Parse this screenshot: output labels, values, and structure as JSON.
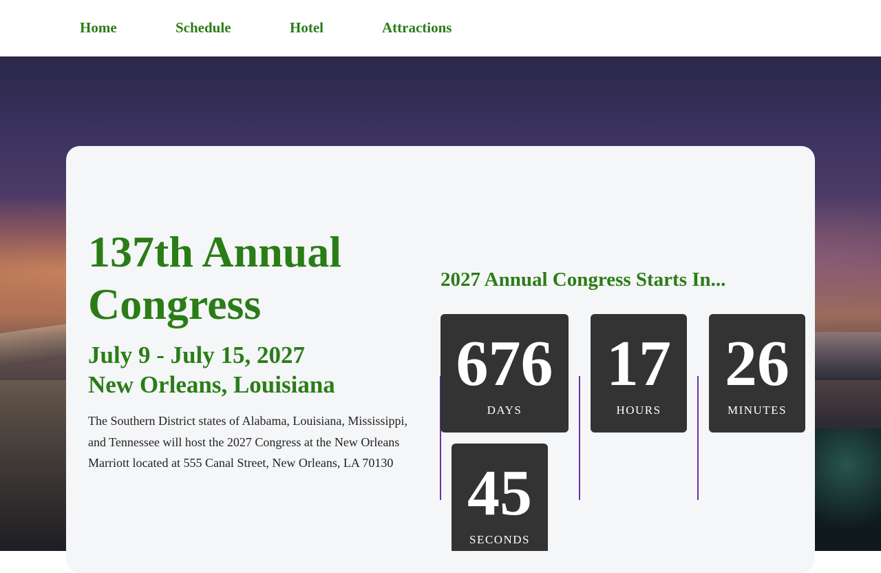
{
  "nav": {
    "items": [
      {
        "label": "Home"
      },
      {
        "label": "Schedule"
      },
      {
        "label": "Hotel"
      },
      {
        "label": "Attractions"
      }
    ]
  },
  "event": {
    "title": "137th Annual Congress",
    "dates": "July 9 - July 15, 2027",
    "location": "New Orleans, Louisiana",
    "description": "The Southern District states of Alabama, Louisiana, Mississippi, and Tennessee will host the 2027 Congress at the New Orleans Marriott located at 555 Canal Street, New Orleans, LA 70130"
  },
  "countdown": {
    "heading": "2027 Annual Congress Starts In...",
    "units": [
      {
        "value": "676",
        "label": "DAYS"
      },
      {
        "value": "17",
        "label": "HOURS"
      },
      {
        "value": "26",
        "label": "MINUTES"
      },
      {
        "value": "45",
        "label": "SECONDS"
      }
    ]
  },
  "colors": {
    "accent_green": "#2a7d16",
    "countdown_box": "#333333",
    "divider_purple": "#6a2fa8",
    "card_background": "#f5f6f8"
  }
}
